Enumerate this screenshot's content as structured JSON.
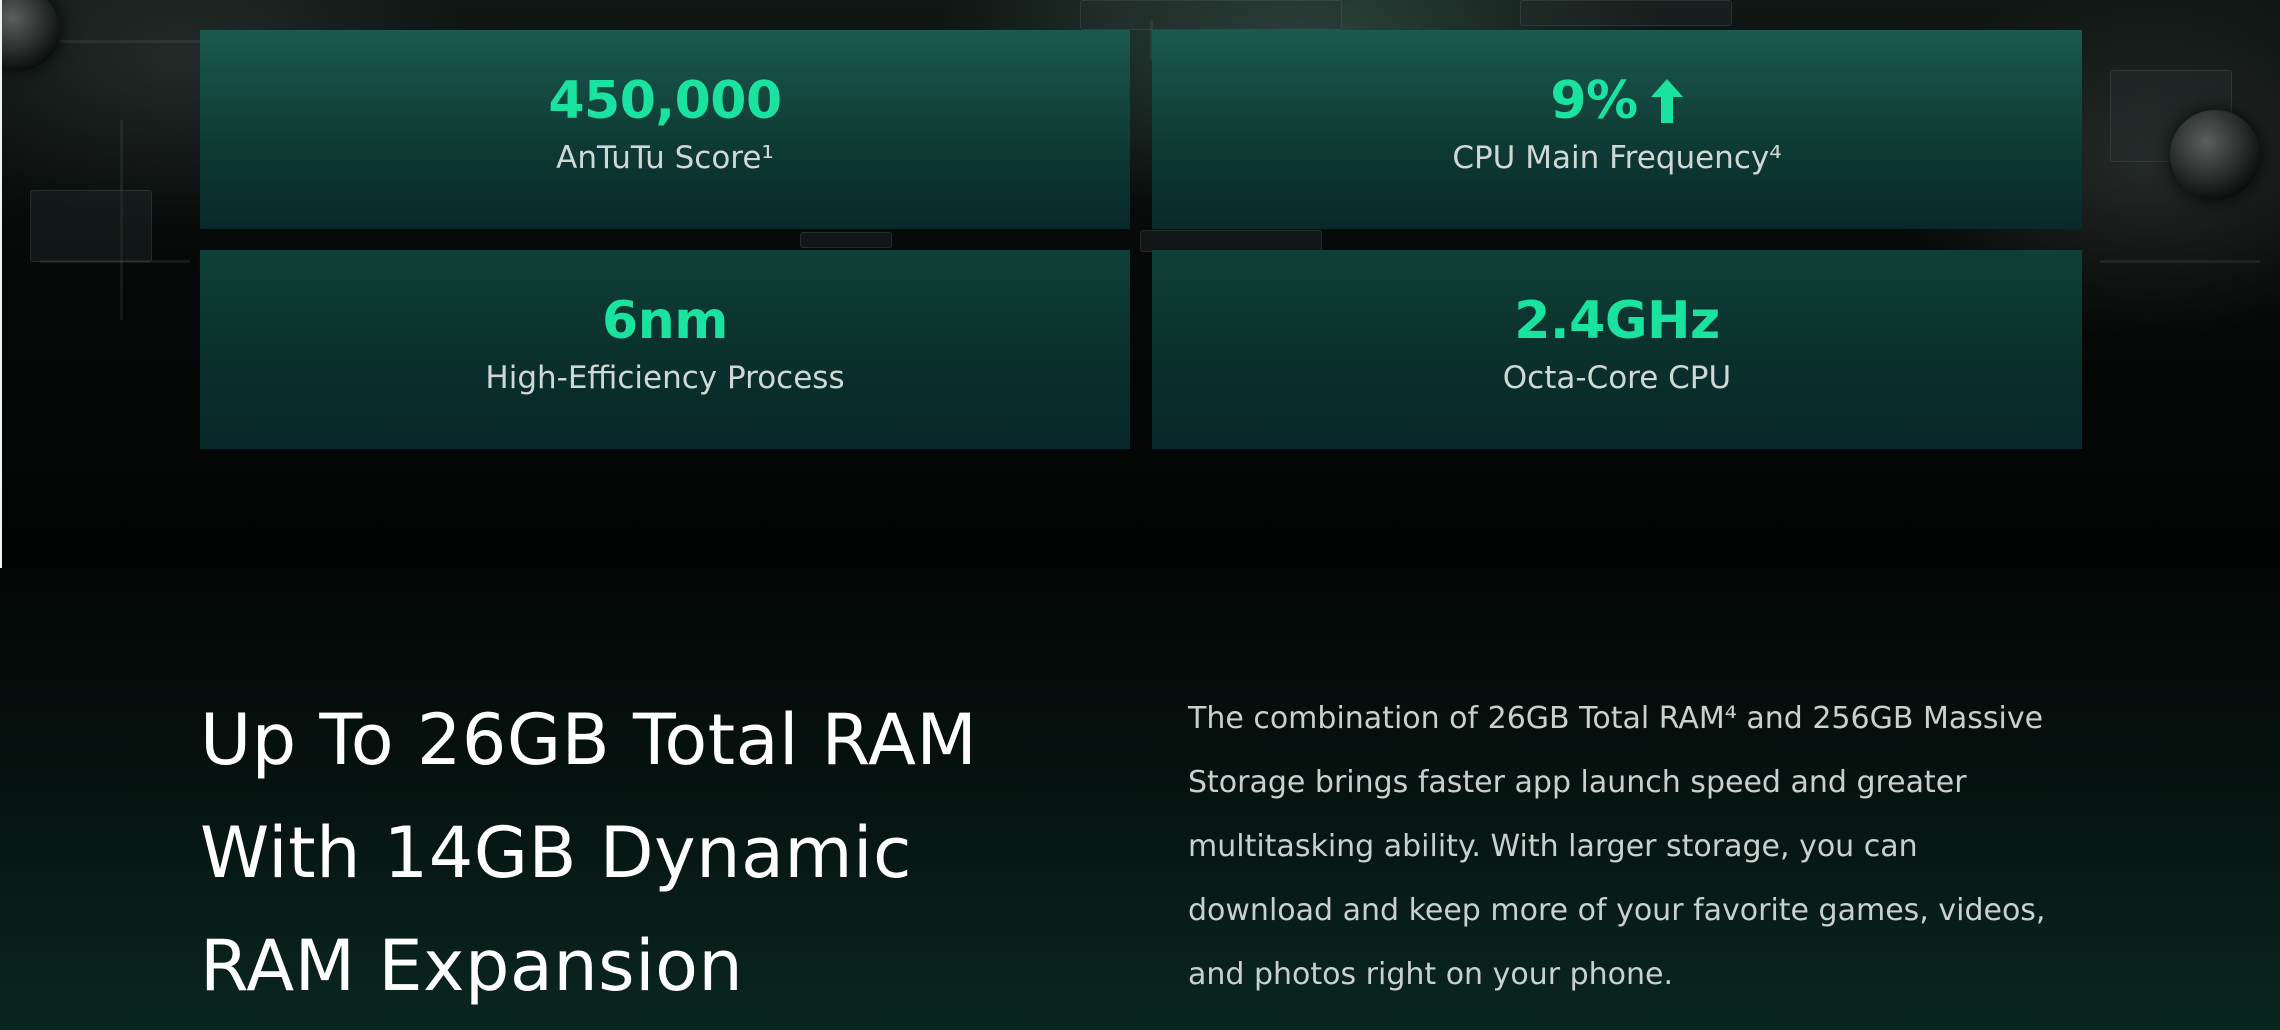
{
  "stats": [
    {
      "value": "450,000",
      "label": "AnTuTu Score¹"
    },
    {
      "value": "9%",
      "label": "CPU Main Frequency⁴",
      "icon": "arrow-up-icon"
    },
    {
      "value": "6nm",
      "label": "High-Efficiency Process"
    },
    {
      "value": "2.4GHz",
      "label": "Octa-Core CPU"
    }
  ],
  "ram_section": {
    "heading_lines": [
      "Up To 26GB Total RAM",
      "With 14GB Dynamic",
      "RAM Expansion"
    ],
    "description_lines": [
      "The combination of 26GB Total RAM⁴ and 256GB Massive",
      "Storage brings faster app launch speed and greater",
      "multitasking ability. With larger storage, you can",
      "download and keep more of your favorite games, videos,",
      "and photos right on your phone."
    ]
  },
  "colors": {
    "accent": "#1ae3a0",
    "card_top": "#1b5a4f",
    "card_bottom": "#08292a",
    "heading_text": "#ffffff",
    "body_text": "#c9d0ce"
  }
}
